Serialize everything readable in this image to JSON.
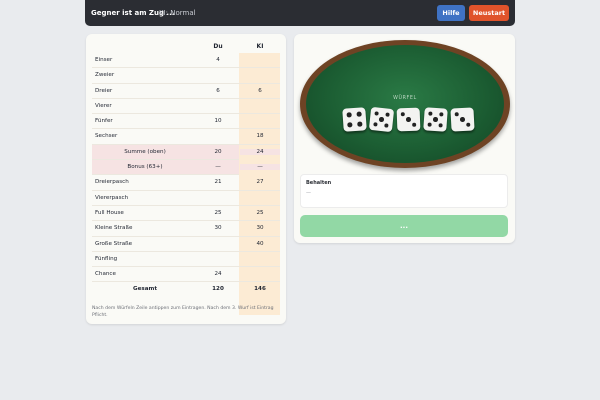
{
  "header": {
    "status": "Gegner ist am Zug ...",
    "mode": "KI: Normal",
    "help_label": "Hilfe",
    "restart_label": "Neustart"
  },
  "sheet": {
    "col_du": "Du",
    "col_ki": "KI",
    "rows": [
      {
        "label": "Einser",
        "du": "4",
        "ki": ""
      },
      {
        "label": "Zweier",
        "du": "",
        "ki": ""
      },
      {
        "label": "Dreier",
        "du": "6",
        "ki": "6"
      },
      {
        "label": "Vierer",
        "du": "",
        "ki": ""
      },
      {
        "label": "Fünfer",
        "du": "10",
        "ki": ""
      },
      {
        "label": "Sechser",
        "du": "",
        "ki": "18"
      },
      {
        "label": "Summe (oben)",
        "du": "20",
        "ki": "24"
      },
      {
        "label": "Bonus (63+)",
        "du": "—",
        "ki": "—"
      },
      {
        "label": "Dreierpasch",
        "du": "21",
        "ki": "27"
      },
      {
        "label": "Viererpasch",
        "du": "",
        "ki": ""
      },
      {
        "label": "Full House",
        "du": "25",
        "ki": "25"
      },
      {
        "label": "Kleine Straße",
        "du": "30",
        "ki": "30"
      },
      {
        "label": "Große Straße",
        "du": "",
        "ki": "40"
      },
      {
        "label": "Fünfling",
        "du": "",
        "ki": ""
      },
      {
        "label": "Chance",
        "du": "24",
        "ki": ""
      }
    ],
    "total": {
      "label": "Gesamt",
      "du": "120",
      "ki": "146"
    },
    "note": "Nach dem Würfeln Zeile antippen zum Eintragen. Nach dem 3. Wurf ist Eintrag Pflicht."
  },
  "board": {
    "label": "WÜRFEL",
    "dice": [
      4,
      5,
      3,
      5,
      3
    ]
  },
  "kept": {
    "title": "Behalten",
    "value": "—"
  },
  "roll_button_label": "..."
}
